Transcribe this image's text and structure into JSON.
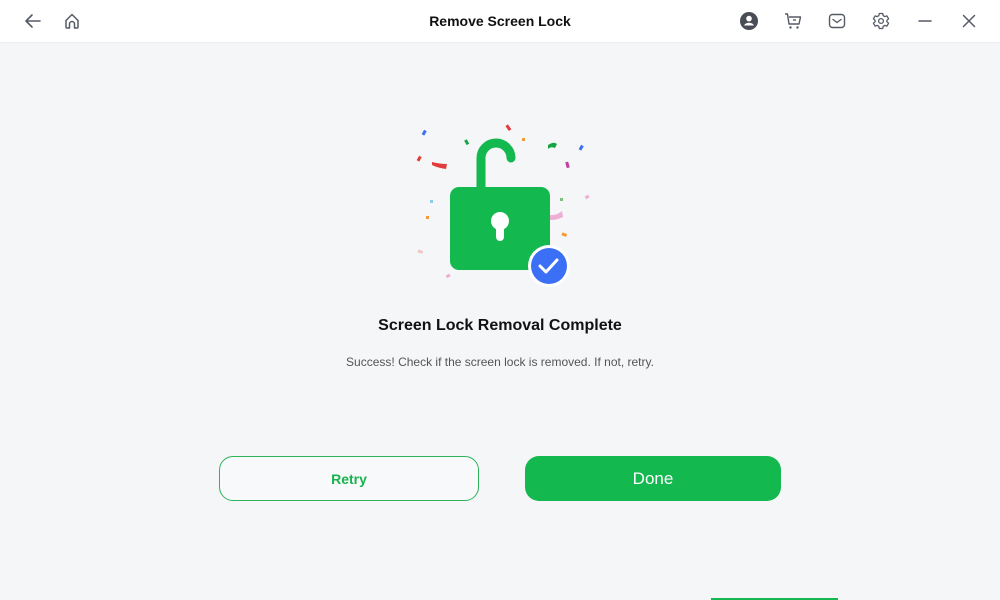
{
  "window": {
    "title": "Remove Screen Lock",
    "icons": {
      "back": "arrow-left-icon",
      "home": "home-icon",
      "account": "user-circle-icon",
      "cart": "shopping-cart-icon",
      "mail": "mail-icon",
      "settings": "gear-icon",
      "minimize": "minimize-icon",
      "close": "close-icon"
    }
  },
  "result": {
    "illustration": "unlocked-padlock-with-check-icon",
    "heading": "Screen Lock Removal Complete",
    "message": "Success! Check if the screen lock is removed. If not, retry."
  },
  "actions": {
    "retry_label": "Retry",
    "done_label": "Done"
  },
  "colors": {
    "accent": "#13b84f",
    "check_badge": "#3b6ff5",
    "background": "#f5f6f8"
  }
}
